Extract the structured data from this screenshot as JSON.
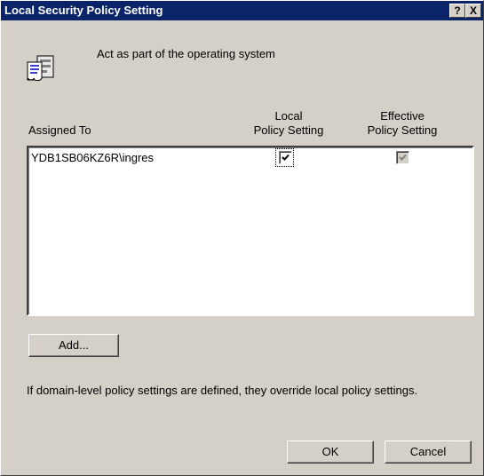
{
  "window": {
    "title": "Local Security Policy Setting",
    "help_label": "?",
    "close_label": "X"
  },
  "policy": {
    "name": "Act as part of the operating system",
    "icon": "policy-document-icon"
  },
  "columns": {
    "assigned_to": "Assigned To",
    "local_line1": "Local",
    "local_line2": "Policy Setting",
    "effective_line1": "Effective",
    "effective_line2": "Policy Setting"
  },
  "rows": [
    {
      "user": "YDB1SB06KZ6R\\ingres",
      "local_checked": true,
      "effective_checked": true
    }
  ],
  "buttons": {
    "add": "Add...",
    "ok": "OK",
    "cancel": "Cancel"
  },
  "note": "If domain-level policy settings are defined, they override local policy settings.",
  "colors": {
    "titlebar": "#0a246a",
    "face": "#d4d0c8"
  }
}
